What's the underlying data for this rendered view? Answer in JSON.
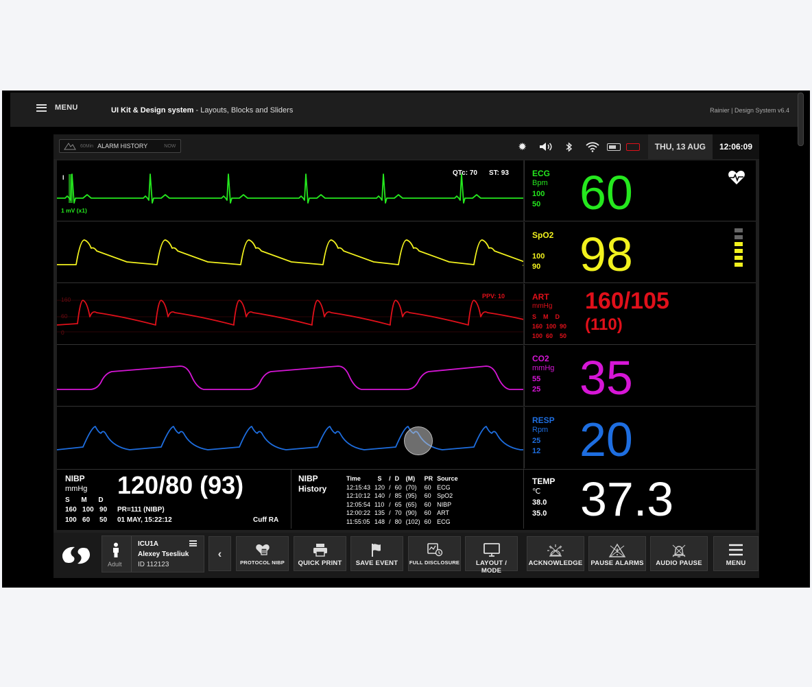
{
  "topbar": {
    "menu_label": "MENU",
    "title_bold": "UI Kit & Design system",
    "title_rest": " - Layouts, Blocks and Sliders",
    "version": "Rainier | Design System  v6.4"
  },
  "status": {
    "alarm_interval": "60Min",
    "alarm_history": "ALARM HISTORY",
    "alarm_now": "NOW",
    "date": "THU, 13 AUG",
    "time": "12:06:09"
  },
  "waves": {
    "ecg": {
      "lead": "I",
      "scale": "1 mV (x1)",
      "qtc": "QTc: 70",
      "st": "ST: 93",
      "color": "#25e81e"
    },
    "spo2": {
      "color": "#f2f21e"
    },
    "art": {
      "scale_top": "160",
      "scale_mid": "60",
      "scale_bot": "0",
      "ppv": "PPV: 10",
      "color": "#e0101a"
    },
    "co2": {
      "color": "#d616d6"
    },
    "resp": {
      "color": "#1e6ee0"
    }
  },
  "params": {
    "ecg": {
      "label": "ECG",
      "unit": "Bpm",
      "hi": "100",
      "lo": "50",
      "value": "60",
      "icon": "heart-pulse-icon"
    },
    "spo2": {
      "label": "SpO2",
      "hi": "100",
      "lo": "90",
      "value": "98",
      "signal_level": 4,
      "signal_max": 6
    },
    "art": {
      "label": "ART",
      "unit": "mmHg",
      "smd": "S    M    D",
      "hi": "160  100  90",
      "lo": "100  60    50",
      "value": "160/105",
      "mean": "(110)"
    },
    "co2": {
      "label": "CO2",
      "unit": "mmHg",
      "hi": "55",
      "lo": "25",
      "value": "35"
    },
    "resp": {
      "label": "RESP",
      "unit": "Rpm",
      "hi": "25",
      "lo": "12",
      "value": "20"
    }
  },
  "nibp": {
    "label": "NIBP",
    "unit": "mmHg",
    "smd": "S      M      D",
    "hi": "160   100   90",
    "lo": "100   60     50",
    "value": "120/80 (93)",
    "pr": "PR=111 (NIBP)",
    "datetime": "01 MAY, 15:22:12",
    "cuff": "Cuff RA"
  },
  "history": {
    "title_1": "NIBP",
    "title_2": "History",
    "headers": [
      "Time",
      "S",
      "/",
      "D",
      "(M)",
      "PR",
      "Source"
    ],
    "rows": [
      [
        "12:15:43",
        "120",
        "/",
        "60",
        "(70)",
        "60",
        "ECG"
      ],
      [
        "12:10:12",
        "140",
        "/",
        "85",
        "(95)",
        "60",
        "SpO2"
      ],
      [
        "12:05:54",
        "110",
        "/",
        "65",
        "(65)",
        "60",
        "NIBP"
      ],
      [
        "12:00:22",
        "135",
        "/",
        "70",
        "(90)",
        "60",
        "ART"
      ],
      [
        "11:55:05",
        "148",
        "/",
        "80",
        "(102)",
        "60",
        "ECG"
      ]
    ]
  },
  "temp": {
    "label": "TEMP",
    "unit": "℃",
    "hi": "38.0",
    "lo": "35.0",
    "value": "37.3"
  },
  "patient": {
    "type": "Adult",
    "unit": "ICU1A",
    "name": "Alexey Tsesliuk",
    "id": "ID 112123"
  },
  "toolbar": {
    "protocol_nibp": "PROTOCOL NIBP",
    "quick_print": "QUICK PRINT",
    "save_event": "SAVE EVENT",
    "full_disclosure": "FULL DISCLOSURE",
    "layout_mode": "LAYOUT / MODE",
    "acknowledge": "ACKNOWLEDGE",
    "pause_alarms": "PAUSE ALARMS",
    "audio_pause": "AUDIO PAUSE",
    "menu": "MENU"
  }
}
